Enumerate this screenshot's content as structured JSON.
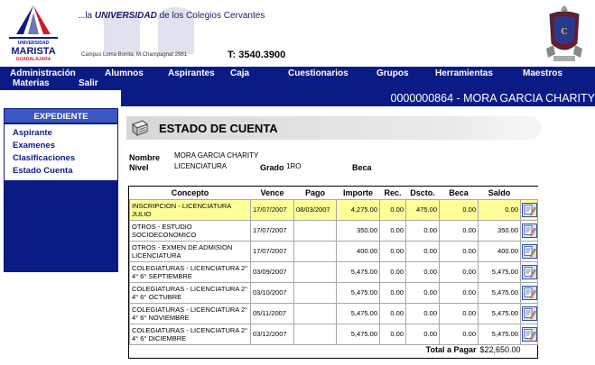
{
  "header": {
    "tagline_prefix": "...la ",
    "tagline_bold": "UNIVERSIDAD",
    "tagline_suffix": " de los Colegios Cervantes",
    "logo_line1": "UNIVERSIDAD",
    "logo_line2": "MARISTA",
    "logo_line3": "GUADALAJARA",
    "campus": "Campus Loma Bonita, M.Champagnat 2981",
    "phone": "T: 3540.3900",
    "brand_color": "#0b1b86",
    "accent_color": "#d01c2a"
  },
  "nav": {
    "row1": [
      "Administración",
      "Alumnos",
      "Aspirantes",
      "Caja",
      "Cuestionarios",
      "Grupos",
      "Herramientas",
      "Maestros"
    ],
    "row2": [
      "Materias",
      "Salir"
    ]
  },
  "account": "0000000864 - MORA GARCIA CHARITY",
  "sidebar": {
    "title": "EXPEDIENTE",
    "items": [
      "Aspirante",
      "Examenes",
      "Clasificaciones",
      "Estado Cuenta"
    ]
  },
  "page_title": "ESTADO DE CUENTA",
  "info": {
    "nombre_label": "Nombre",
    "nombre_value": "MORA GARCIA CHARITY",
    "nivel_label": "Nivel",
    "nivel_value": "LICENCIATURA",
    "grado_label": "Grado",
    "grado_value": "1RO",
    "beca_label": "Beca",
    "beca_value": ""
  },
  "table": {
    "headers": [
      "Concepto",
      "Vence",
      "Pago",
      "Importe",
      "Rec.",
      "Dscto.",
      "Beca",
      "Saldo"
    ],
    "rows": [
      {
        "concepto": "INSCRIPCION - LICENCIATURA JULIO",
        "vence": "17/07/2007",
        "pago": "08/03/2007",
        "importe": "4,275.00",
        "rec": "0.00",
        "dscto": "475.00",
        "beca": "0.00",
        "saldo": "0.00",
        "highlight": true
      },
      {
        "concepto": "OTROS - ESTUDIO SOCIOECONOMICO",
        "vence": "17/07/2007",
        "pago": "",
        "importe": "350.00",
        "rec": "0.00",
        "dscto": "0.00",
        "beca": "0.00",
        "saldo": "350.00",
        "highlight": false
      },
      {
        "concepto": "OTROS - EXMEN DE ADMISION LICENCIATURA",
        "vence": "17/07/2007",
        "pago": "",
        "importe": "400.00",
        "rec": "0.00",
        "dscto": "0.00",
        "beca": "0.00",
        "saldo": "400.00",
        "highlight": false
      },
      {
        "concepto": "COLEGIATURAS - LICENCIATURA 2° 4° 6° SEPTIEMBRE",
        "vence": "03/09/2007",
        "pago": "",
        "importe": "5,475.00",
        "rec": "0.00",
        "dscto": "0.00",
        "beca": "0.00",
        "saldo": "5,475.00",
        "highlight": false
      },
      {
        "concepto": "COLEGIATURAS - LICENCIATURA 2° 4° 6° OCTUBRE",
        "vence": "03/10/2007",
        "pago": "",
        "importe": "5,475.00",
        "rec": "0.00",
        "dscto": "0.00",
        "beca": "0.00",
        "saldo": "5,475.00",
        "highlight": false
      },
      {
        "concepto": "COLEGIATURAS - LICENCIATURA 2° 4° 6° NOVIEMBRE",
        "vence": "05/11/2007",
        "pago": "",
        "importe": "5,475.00",
        "rec": "0.00",
        "dscto": "0.00",
        "beca": "0.00",
        "saldo": "5,475.00",
        "highlight": false
      },
      {
        "concepto": "COLEGIATURAS - LICENCIATURA 2° 4° 6° DICIEMBRE",
        "vence": "03/12/2007",
        "pago": "",
        "importe": "5,475.00",
        "rec": "0.00",
        "dscto": "0.00",
        "beca": "0.00",
        "saldo": "5,475.00",
        "highlight": false
      }
    ],
    "total_label": "Total a Pagar",
    "total_value": "$22,650.00",
    "row_action_icon": "edit-document-icon",
    "highlight_color": "#ffff99"
  }
}
